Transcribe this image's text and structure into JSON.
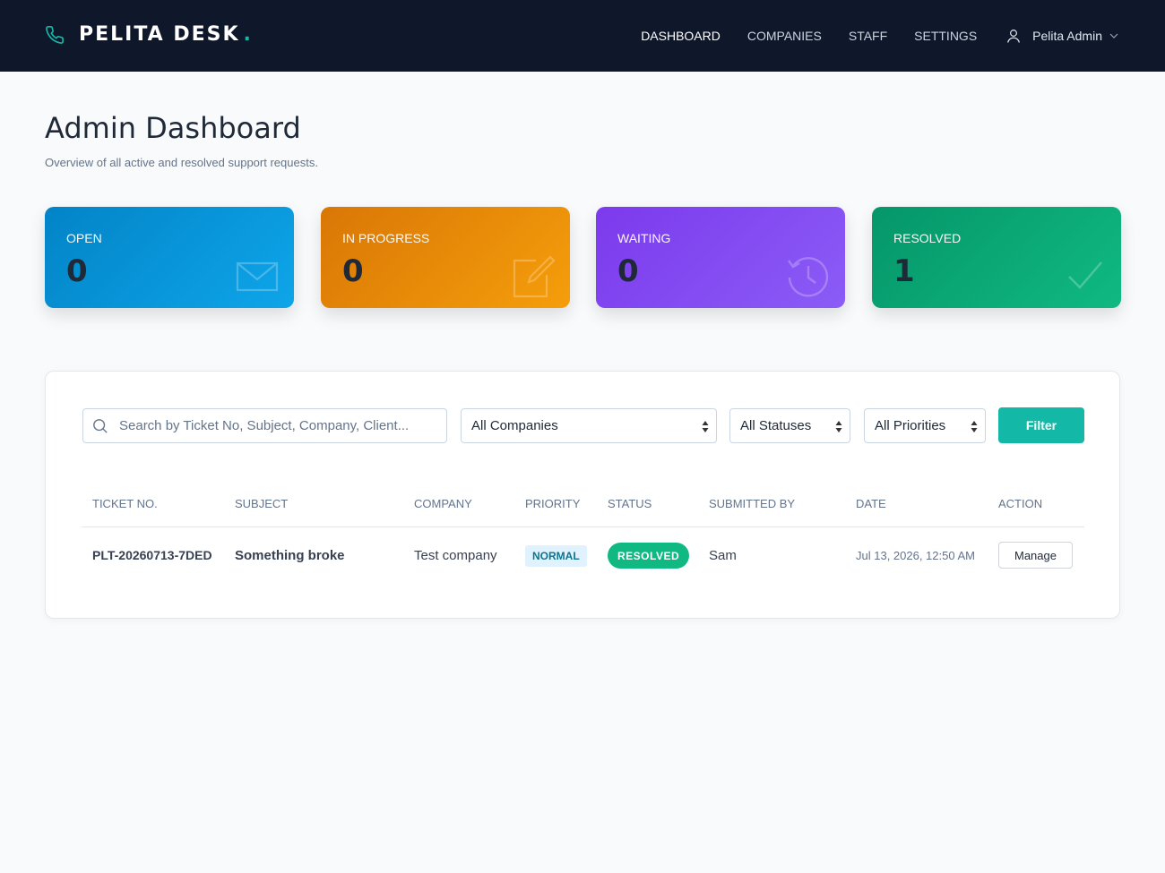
{
  "brand": {
    "name": "PELITA DESK",
    "dot": ".",
    "icon": "phone-icon"
  },
  "nav": {
    "items": [
      {
        "label": "DASHBOARD",
        "active": true
      },
      {
        "label": "COMPANIES",
        "active": false
      },
      {
        "label": "STAFF",
        "active": false
      },
      {
        "label": "SETTINGS",
        "active": false
      }
    ],
    "user": {
      "name": "Pelita Admin",
      "icon": "user-icon"
    }
  },
  "page": {
    "title": "Admin Dashboard",
    "subtitle": "Overview of all active and resolved support requests."
  },
  "stats": [
    {
      "label": "OPEN",
      "value": "0",
      "icon": "envelope-icon",
      "color": "#0ea5e9"
    },
    {
      "label": "IN PROGRESS",
      "value": "0",
      "icon": "edit-icon",
      "color": "#f59e0b"
    },
    {
      "label": "WAITING",
      "value": "0",
      "icon": "history-icon",
      "color": "#8b5cf6"
    },
    {
      "label": "RESOLVED",
      "value": "1",
      "icon": "check-icon",
      "color": "#10b981"
    }
  ],
  "filters": {
    "search_placeholder": "Search by Ticket No, Subject, Company, Client...",
    "company": "All Companies",
    "status": "All Statuses",
    "priority": "All Priorities",
    "filter_label": "Filter"
  },
  "table": {
    "headers": [
      "TICKET NO.",
      "SUBJECT",
      "COMPANY",
      "PRIORITY",
      "STATUS",
      "SUBMITTED BY",
      "DATE",
      "ACTION"
    ],
    "rows": [
      {
        "ticket": "PLT-20260713-7DED",
        "subject": "Something broke",
        "company": "Test company",
        "priority": "NORMAL",
        "status": "RESOLVED",
        "submitted_by": "Sam",
        "date": "Jul 13, 2026, 12:50 AM",
        "action": "Manage"
      }
    ]
  },
  "colors": {
    "accent": "#14b8a6",
    "header_bg": "#0f172a"
  }
}
